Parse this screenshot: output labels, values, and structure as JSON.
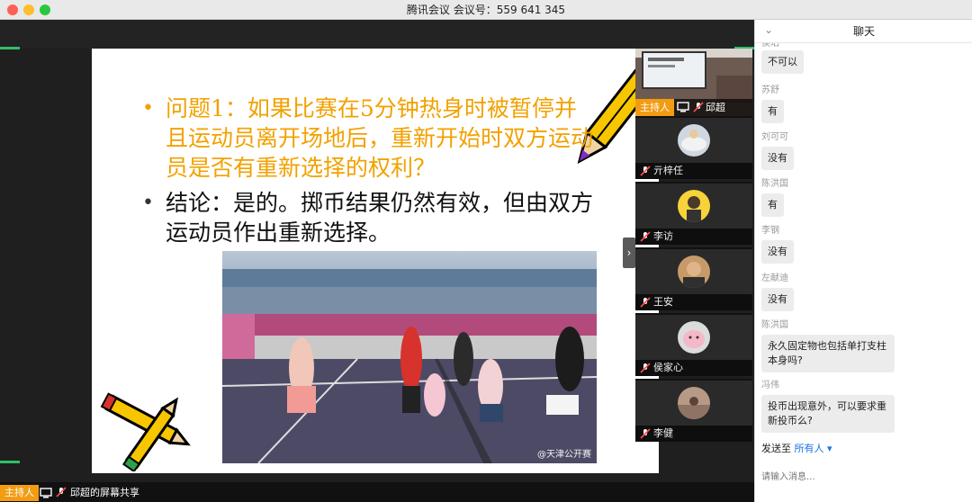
{
  "window": {
    "title": "腾讯会议 会议号：559 641 345"
  },
  "slide": {
    "bullet1": "问题1：如果比赛在5分钟热身时被暂停并且运动员离开场地后，重新开始时双方运动员是否有重新选择的权利？",
    "bullet2": "结论：是的。掷币结果仍然有效，但由双方运动员作出重新选择。",
    "photo_caption": "@天津公开赛",
    "bullet_symbol": "•",
    "next_arrow": "›"
  },
  "participants": {
    "top": {
      "host_badge": "主持人",
      "name": "邱超"
    },
    "list": [
      {
        "name": "亓梓任"
      },
      {
        "name": "李访"
      },
      {
        "name": "王安"
      },
      {
        "name": "侯家心"
      },
      {
        "name": "李健"
      }
    ]
  },
  "bottombar": {
    "host_badge": "主持人",
    "share_label": "邱超的屏幕共享"
  },
  "chat": {
    "title": "聊天",
    "partial_sender": "侯珀",
    "messages": [
      {
        "sender": "",
        "text": "不可以"
      },
      {
        "sender": "苏舒",
        "text": "有"
      },
      {
        "sender": "刘可可",
        "text": "没有"
      },
      {
        "sender": "陈洪国",
        "text": "有"
      },
      {
        "sender": "李钢",
        "text": "没有"
      },
      {
        "sender": "左献迪",
        "text": "没有"
      },
      {
        "sender": "陈洪国",
        "text": "永久固定物也包括单打支柱本身吗?"
      },
      {
        "sender": "冯伟",
        "text": "投币出现意外，可以要求重新投币么?"
      }
    ],
    "send_to_label": "发送至",
    "send_to_target": "所有人",
    "input_placeholder": "请输入消息..."
  },
  "colors": {
    "host_orange": "#f39c12",
    "question_orange": "#f2a100",
    "link_blue": "#1a73e8"
  }
}
